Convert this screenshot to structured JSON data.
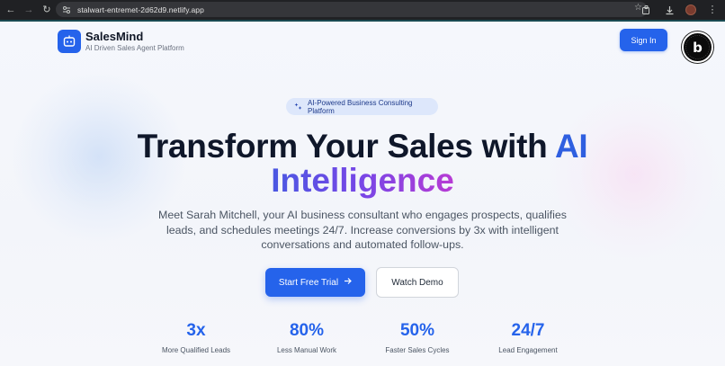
{
  "browser": {
    "url": "stalwart-entremet-2d62d9.netlify.app"
  },
  "header": {
    "brand": "SalesMind",
    "tagline": "AI Driven Sales Agent Platform",
    "signin_label": "Sign In",
    "logo_icon": "robot-icon",
    "badge_icon": "bolt-badge-icon"
  },
  "hero": {
    "pill_label": "AI-Powered Business Consulting Platform",
    "headline_part1": "Transform Your Sales with ",
    "headline_ai": "AI",
    "headline_part2": "Intelligence",
    "description": "Meet Sarah Mitchell, your AI business consultant who engages prospects, qualifies leads, and schedules meetings 24/7. Increase conversions by 3x with intelligent conversations and automated follow-ups.",
    "primary_cta": "Start Free Trial",
    "secondary_cta": "Watch Demo"
  },
  "stats": [
    {
      "value": "3x",
      "label": "More Qualified Leads"
    },
    {
      "value": "80%",
      "label": "Less Manual Work"
    },
    {
      "value": "50%",
      "label": "Faster Sales Cycles"
    },
    {
      "value": "24/7",
      "label": "Lead Engagement"
    }
  ],
  "colors": {
    "accent": "#2563eb",
    "gradient_start": "#4a58e2",
    "gradient_end": "#b83bd4"
  }
}
